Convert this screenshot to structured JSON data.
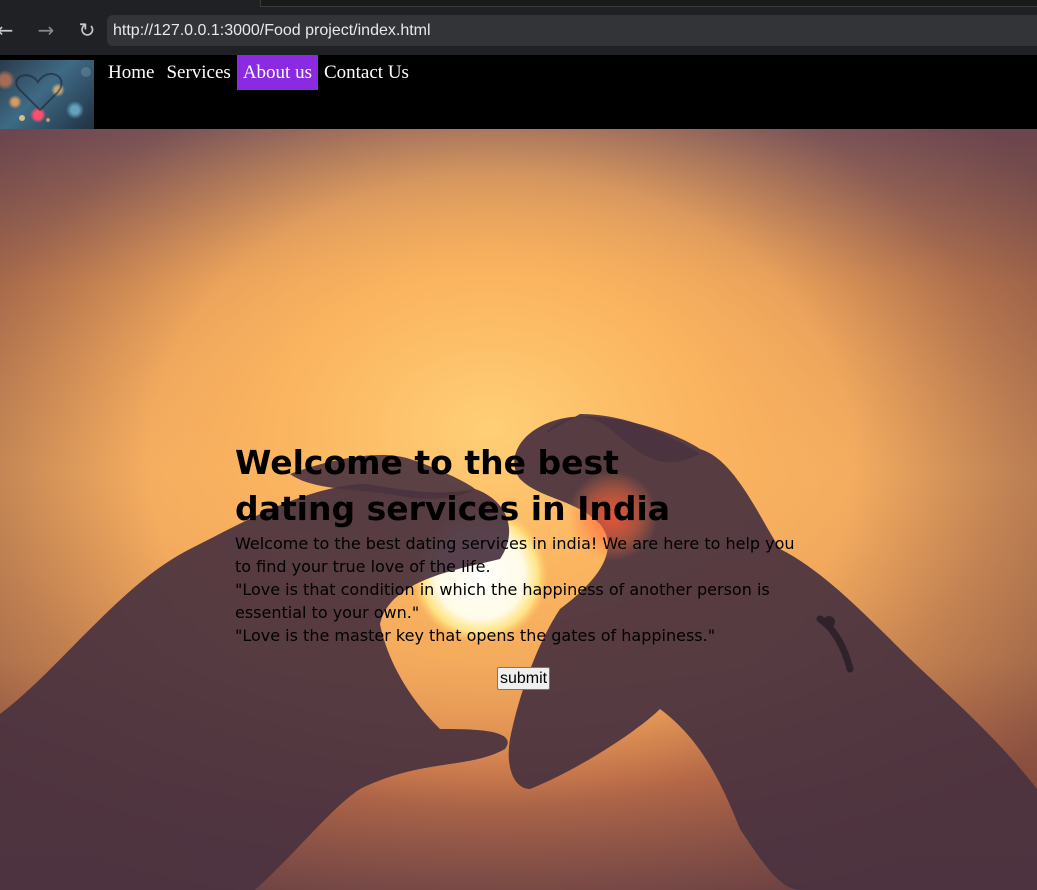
{
  "browser": {
    "back_icon": "arrow-left-icon",
    "forward_icon": "arrow-right-icon",
    "reload_icon": "reload-icon",
    "url": "http://127.0.0.1:3000/Food project/index.html"
  },
  "nav": {
    "logo_icon": "heart-bokeh-logo",
    "links": [
      {
        "label": "Home",
        "active": false
      },
      {
        "label": "Services",
        "active": false
      },
      {
        "label": "About us",
        "active": true
      },
      {
        "label": "Contact Us",
        "active": false
      }
    ],
    "active_color": "#8a2be2"
  },
  "main": {
    "heading": "Welcome to the best dating services in India",
    "paragraphs": [
      "Welcome to the best dating services in india! We are here to help you to find your true love of the life.",
      "\"Love is that condition in which the happiness of another person is essential to your own.\"",
      "\"Love is the master key that opens the gates of happiness.\""
    ],
    "submit_label": "submit"
  }
}
